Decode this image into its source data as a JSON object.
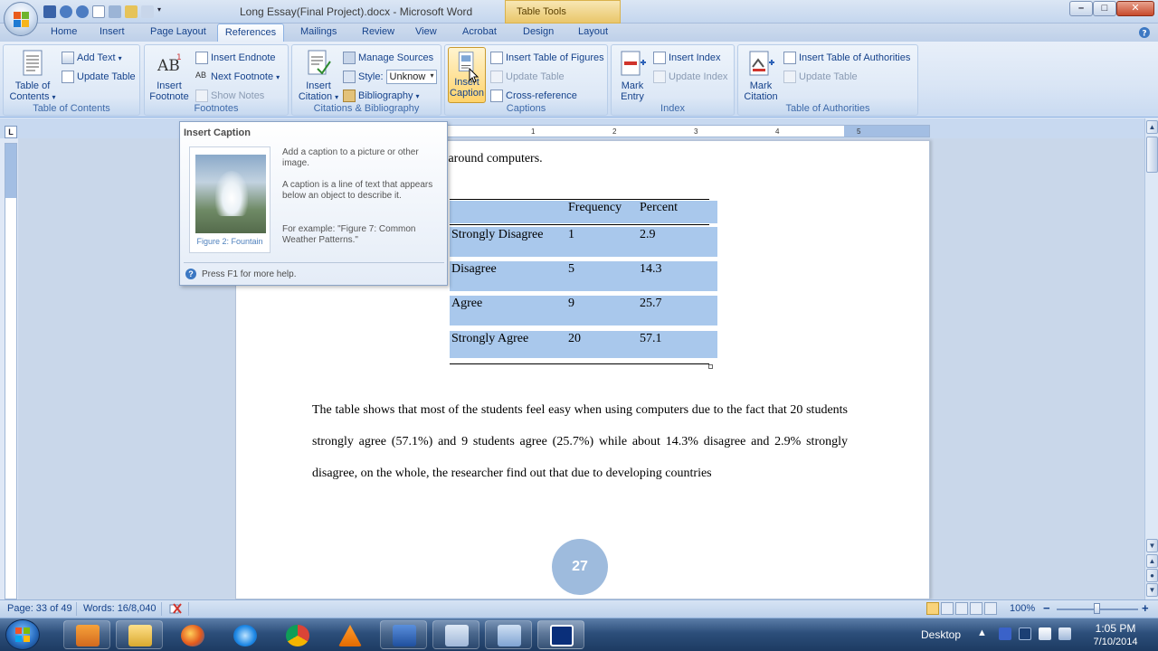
{
  "window": {
    "title": "Long Essay(Final Project).docx - Microsoft Word",
    "contextual_tab": "Table Tools",
    "controls": {
      "minimize": "–",
      "maximize": "□",
      "close": "✕"
    }
  },
  "tabs": [
    {
      "label": "Home"
    },
    {
      "label": "Insert"
    },
    {
      "label": "Page Layout"
    },
    {
      "label": "References"
    },
    {
      "label": "Mailings"
    },
    {
      "label": "Review"
    },
    {
      "label": "View"
    },
    {
      "label": "Acrobat"
    },
    {
      "label": "Design"
    },
    {
      "label": "Layout"
    }
  ],
  "active_tab": "References",
  "ribbon": {
    "toc": {
      "label": "Table of Contents",
      "toc_btn_1": "Table of",
      "toc_btn_2": "Contents",
      "add_text": "Add Text",
      "update_table": "Update Table"
    },
    "footnotes": {
      "label": "Footnotes",
      "insert_footnote_1": "Insert",
      "insert_footnote_2": "Footnote",
      "insert_endnote": "Insert Endnote",
      "next_footnote": "Next Footnote",
      "show_notes": "Show Notes"
    },
    "citations": {
      "label": "Citations & Bibliography",
      "insert_citation_1": "Insert",
      "insert_citation_2": "Citation",
      "manage_sources": "Manage Sources",
      "style_label": "Style:",
      "style_value": "Unknow",
      "bibliography": "Bibliography"
    },
    "captions": {
      "label": "Captions",
      "insert_caption_1": "Insert",
      "insert_caption_2": "Caption",
      "insert_tof": "Insert Table of Figures",
      "update_table": "Update Table",
      "cross_reference": "Cross-reference"
    },
    "index": {
      "label": "Index",
      "mark_entry_1": "Mark",
      "mark_entry_2": "Entry",
      "insert_index": "Insert Index",
      "update_index": "Update Index"
    },
    "toa": {
      "label": "Table of Authorities",
      "mark_citation_1": "Mark",
      "mark_citation_2": "Citation",
      "insert_toa": "Insert Table of Authorities",
      "update_table": "Update Table"
    }
  },
  "tooltip": {
    "title": "Insert Caption",
    "p1": "Add a caption to a picture or other image.",
    "p2": "A caption is a line of text that appears below an object to describe it.",
    "p3": "For example: \"Figure 7: Common Weather Patterns.\"",
    "image_caption": "Figure 2: Fountain",
    "help": "Press F1 for more help."
  },
  "ruler": {
    "corner": "L",
    "ticks": [
      "1",
      "2",
      "3",
      "4",
      "5"
    ]
  },
  "document": {
    "line_top": "views about how they feel around computers.",
    "table": {
      "headers": [
        "",
        "Frequency",
        "Percent"
      ],
      "rows": [
        [
          "Strongly Disagree",
          "1",
          "2.9"
        ],
        [
          "Disagree",
          "5",
          "14.3"
        ],
        [
          "Agree",
          "9",
          "25.7"
        ],
        [
          "Strongly Agree",
          "20",
          "57.1"
        ]
      ]
    },
    "paragraph": "The table shows that most of the students feel easy when using computers due to the fact that 20 students strongly agree (57.1%) and 9 students agree (25.7%) while about 14.3% disagree and 2.9% strongly disagree, on the whole, the researcher find out that due to developing countries",
    "page_number": "27"
  },
  "statusbar": {
    "page": "Page: 33 of 49",
    "words": "Words: 16/8,040",
    "zoom": "100%",
    "zoom_minus": "−",
    "zoom_plus": "+"
  },
  "taskbar": {
    "desktop": "Desktop",
    "time": "1:05 PM",
    "date": "7/10/2014"
  },
  "colors": {
    "selection": "#a9c8ec",
    "ribbon_bg": "#dde8f6",
    "taskbar": "#2c4e7a",
    "page_number_circle": "#9ebbdd"
  }
}
